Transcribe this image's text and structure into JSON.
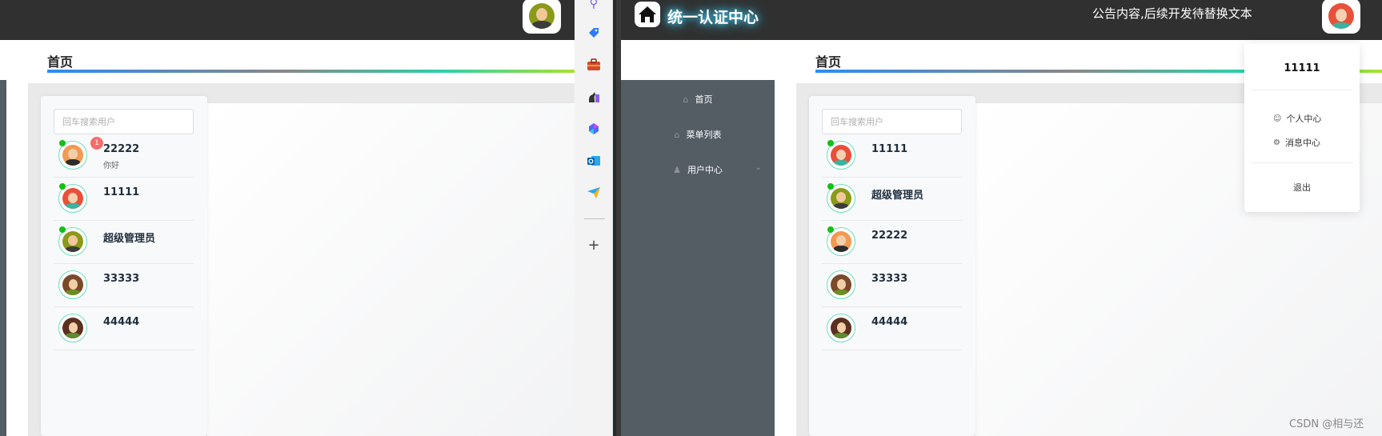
{
  "left_window": {
    "page_title": "首页",
    "search_placeholder": "回车搜索用户",
    "users": [
      {
        "name": "22222",
        "message": "你好",
        "badge": "1",
        "online": true,
        "avatar": "man-beard-avatar"
      },
      {
        "name": "11111",
        "message": "",
        "badge": "",
        "online": true,
        "avatar": "woman-red-hair-avatar"
      },
      {
        "name": "超级管理员",
        "message": "",
        "badge": "",
        "online": true,
        "avatar": "man-green-avatar"
      },
      {
        "name": "33333",
        "message": "",
        "badge": "",
        "online": false,
        "avatar": "woman-brown-hair-avatar"
      },
      {
        "name": "44444",
        "message": "",
        "badge": "",
        "online": false,
        "avatar": "woman-dark-hair-avatar"
      }
    ]
  },
  "side_toolbar": {
    "icons": [
      "search-icon",
      "tag-icon",
      "briefcase-icon",
      "chess-icon",
      "copilot-icon",
      "outlook-icon",
      "send-icon"
    ],
    "add_label": "+"
  },
  "right_window": {
    "app_name": "统一认证中心",
    "notice": "公告内容,后续开发待替换文本",
    "page_title": "首页",
    "menu": [
      {
        "label": "首页",
        "icon": "home-icon"
      },
      {
        "label": "菜单列表",
        "icon": "home-icon"
      },
      {
        "label": "用户中心",
        "icon": "user-icon",
        "has_children": true
      }
    ],
    "search_placeholder": "回车搜索用户",
    "users": [
      {
        "name": "11111",
        "online": true,
        "avatar": "woman-red-hair-avatar"
      },
      {
        "name": "超级管理员",
        "online": true,
        "avatar": "man-green-avatar"
      },
      {
        "name": "22222",
        "online": true,
        "avatar": "man-beard-avatar"
      },
      {
        "name": "33333",
        "online": false,
        "avatar": "woman-brown-hair-avatar"
      },
      {
        "name": "44444",
        "online": false,
        "avatar": "woman-dark-hair-avatar"
      }
    ],
    "dropdown": {
      "username": "11111",
      "items": [
        {
          "label": "个人中心",
          "icon": "user-icon"
        },
        {
          "label": "消息中心",
          "icon": "message-icon"
        }
      ],
      "logout": "退出"
    }
  },
  "watermark": "CSDN @相与还",
  "colors": {
    "header": "#303030",
    "sidebar": "#545c64",
    "online": "#11c211",
    "badge": "#f56c6c",
    "avatar_ring": "#68e0b8"
  }
}
